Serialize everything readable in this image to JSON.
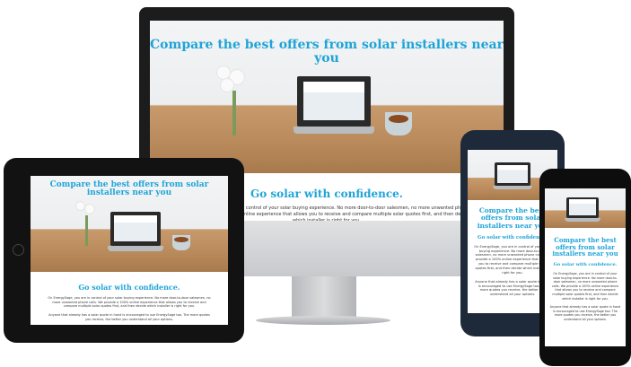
{
  "hero": {
    "headline": "Compare the best offers from solar installers near you"
  },
  "content": {
    "heading": "Go solar with confidence.",
    "body": "On EnergySage, you are in control of your solar buying experience. No more door-to-door salesmen, no more unwanted phone calls. We provide a 100% online experience that allows you to receive and compare multiple solar quotes first, and then decide which installer is right for you.",
    "body2": "Anyone that already has a solar quote in hand is encouraged to use EnergySage too. The more quotes you receive, the better you understand all your options."
  },
  "colors": {
    "accent": "#1fa4d8",
    "desk": "#b98a5b"
  }
}
